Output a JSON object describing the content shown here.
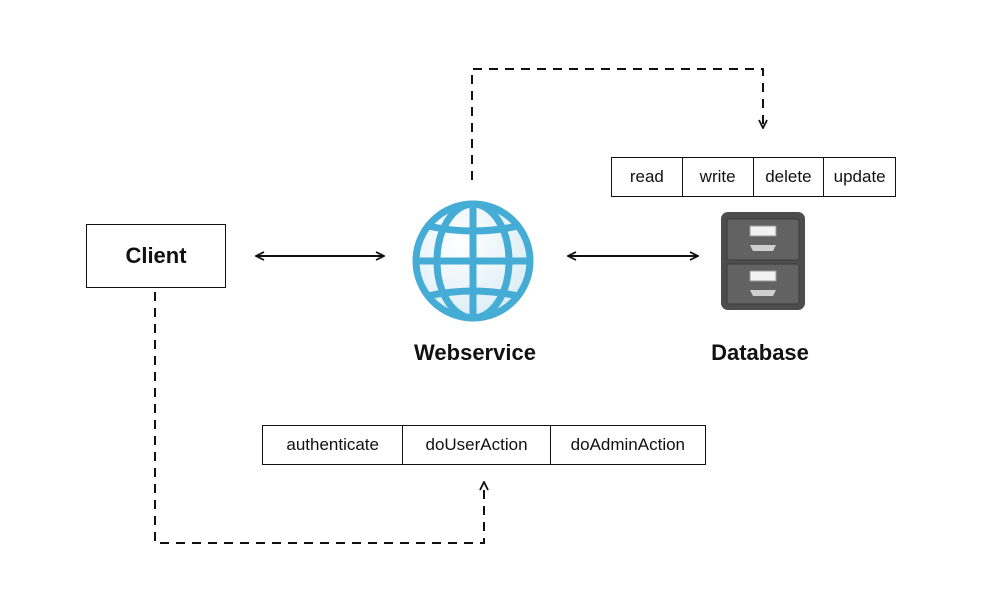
{
  "nodes": {
    "client": {
      "label": "Client"
    },
    "webservice": {
      "label": "Webservice",
      "icon": "globe-icon"
    },
    "database": {
      "label": "Database",
      "icon": "file-cabinet-icon"
    }
  },
  "database_operations": [
    "read",
    "write",
    "delete",
    "update"
  ],
  "webservice_operations": [
    "authenticate",
    "doUserAction",
    "doAdminAction"
  ],
  "connections": [
    {
      "from": "Client",
      "to": "Webservice",
      "style": "solid",
      "direction": "bidirectional"
    },
    {
      "from": "Webservice",
      "to": "Database",
      "style": "solid",
      "direction": "bidirectional"
    },
    {
      "from": "Webservice",
      "to": "Database operations",
      "style": "dashed",
      "direction": "one-way"
    },
    {
      "from": "Client",
      "to": "Webservice operations",
      "style": "dashed",
      "direction": "one-way"
    }
  ],
  "colors": {
    "line": "#111111",
    "globe": "#4fb3d9",
    "cabinet": "#5a5a5a"
  }
}
